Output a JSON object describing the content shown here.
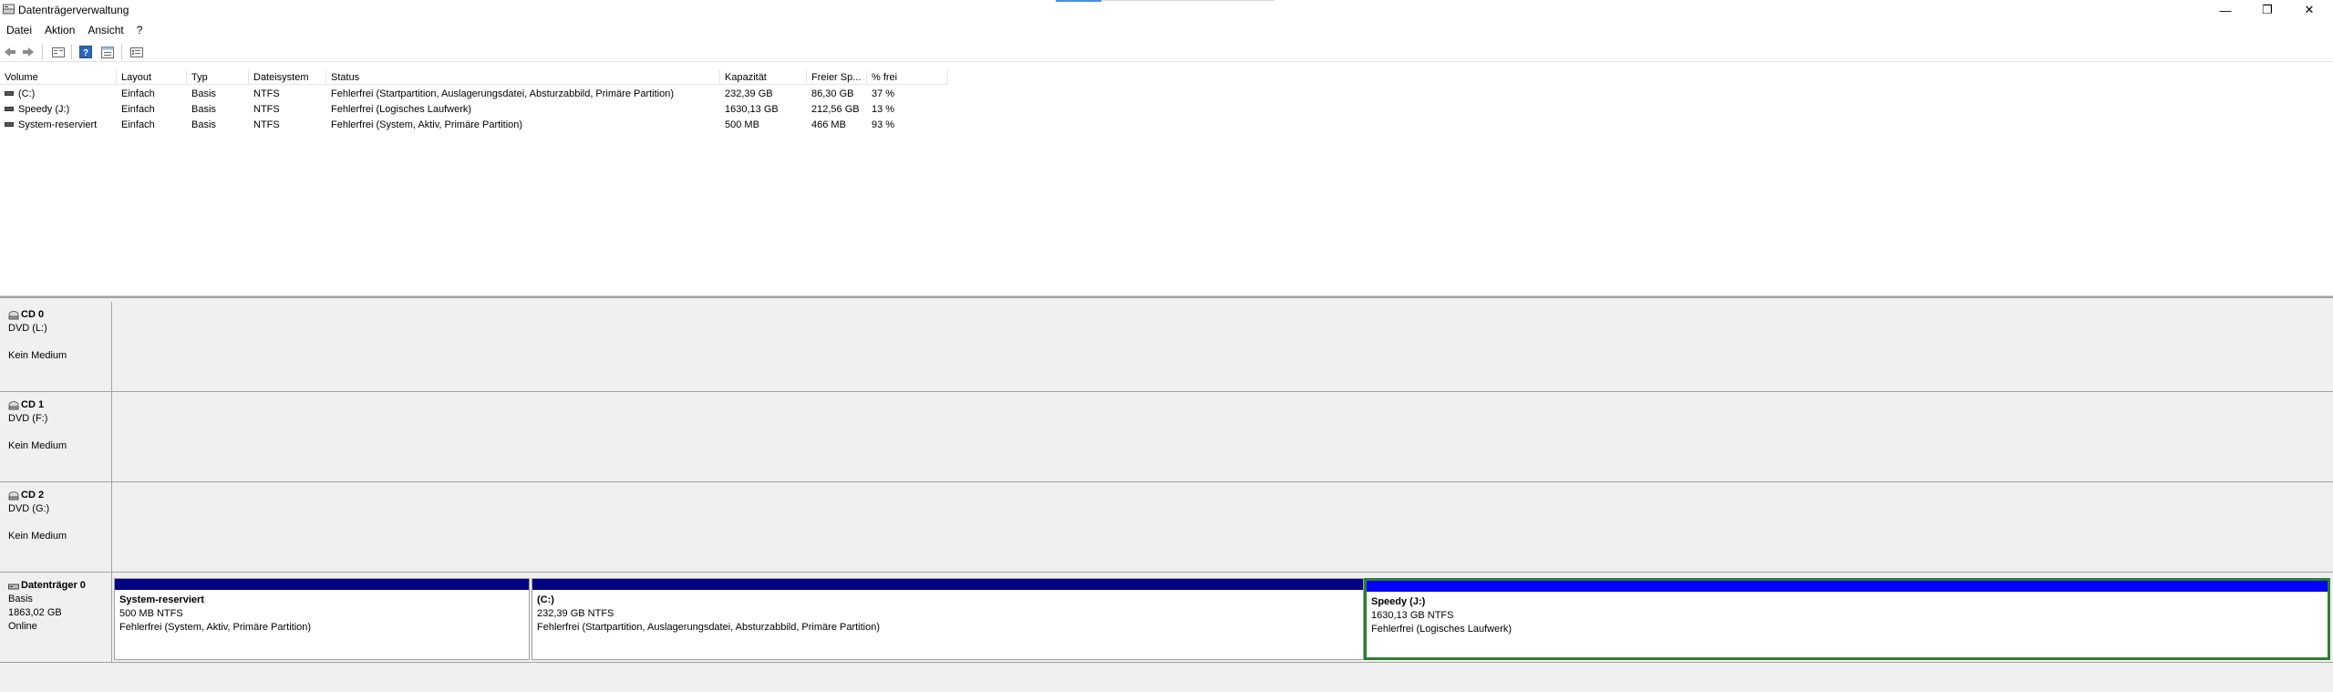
{
  "window": {
    "title": "Datenträgerverwaltung",
    "minimize": "—",
    "restore": "❐",
    "close": "✕"
  },
  "menu": [
    "Datei",
    "Aktion",
    "Ansicht",
    "?"
  ],
  "toolbar": {
    "icons": [
      "back-icon",
      "forward-icon",
      "disk-list-icon",
      "help-icon",
      "properties-icon",
      "settings-icon"
    ]
  },
  "volume_table": {
    "headers": [
      "Volume",
      "Layout",
      "Typ",
      "Dateisystem",
      "Status",
      "Kapazität",
      "Freier Sp...",
      "% frei"
    ],
    "rows": [
      [
        "(C:)",
        "Einfach",
        "Basis",
        "NTFS",
        "Fehlerfrei (Startpartition, Auslagerungsdatei, Absturzabbild, Primäre Partition)",
        "232,39 GB",
        "86,30 GB",
        "37 %"
      ],
      [
        "Speedy (J:)",
        "Einfach",
        "Basis",
        "NTFS",
        "Fehlerfrei (Logisches Laufwerk)",
        "1630,13 GB",
        "212,56 GB",
        "13 %"
      ],
      [
        "System-reserviert",
        "Einfach",
        "Basis",
        "NTFS",
        "Fehlerfrei (System, Aktiv, Primäre Partition)",
        "500 MB",
        "466 MB",
        "93 %"
      ]
    ]
  },
  "disks": [
    {
      "name": "CD 0",
      "line1": "DVD (L:)",
      "line2": "",
      "line3": "Kein Medium"
    },
    {
      "name": "CD 1",
      "line1": "DVD (F:)",
      "line2": "",
      "line3": "Kein Medium"
    },
    {
      "name": "CD 2",
      "line1": "DVD (G:)",
      "line2": "",
      "line3": "Kein Medium"
    },
    {
      "name": "Datenträger 0",
      "line1": "Basis",
      "line2": "1863,02 GB",
      "line3": "Online"
    }
  ],
  "partitions": [
    {
      "name": "System-reserviert",
      "size": "500 MB NTFS",
      "status": "Fehlerfrei (System, Aktiv, Primäre Partition)"
    },
    {
      "name": "(C:)",
      "size": "232,39 GB NTFS",
      "status": "Fehlerfrei (Startpartition, Auslagerungsdatei, Absturzabbild, Primäre Partition)"
    },
    {
      "name": "Speedy  (J:)",
      "size": "1630,13 GB NTFS",
      "status": "Fehlerfrei (Logisches Laufwerk)"
    }
  ],
  "colors": {
    "primary_partition": "#000080",
    "logical_drive": "#0000ff",
    "selection": "#2e7d32"
  }
}
